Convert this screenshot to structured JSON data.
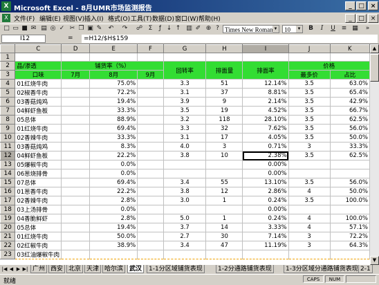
{
  "window": {
    "title": "Microsoft Excel - 8月UMR市场监测报告",
    "minimize": "_",
    "maximize": "□",
    "close": "×",
    "doc_min": "_",
    "doc_max": "□",
    "doc_close": "×"
  },
  "menu": [
    "文件(F)",
    "编辑(E)",
    "视图(V)",
    "插入(I)",
    "格式(O)",
    "工具(T)",
    "数据(D)",
    "窗口(W)",
    "帮助(H)"
  ],
  "toolbar": {
    "font": "Times New Roman",
    "size": "10",
    "bold": "B",
    "italic": "I",
    "underline": "U",
    "icons": [
      "new-icon",
      "open-icon",
      "save-icon",
      "print-icon",
      "preview-icon",
      "spell-icon",
      "cut-icon",
      "copy-icon",
      "paste-icon",
      "undo-icon",
      "redo-icon",
      "hyperlink-icon",
      "autosum-icon",
      "function-icon",
      "sort-asc-icon",
      "sort-desc-icon",
      "chart-icon",
      "drawing-icon",
      "zoom-icon",
      "help-icon"
    ]
  },
  "formula_bar": {
    "name_box": "I12",
    "fx": "=",
    "formula": "=H12/$H$159"
  },
  "columns": [
    "C",
    "D",
    "E",
    "F",
    "G",
    "H",
    "I",
    "J",
    "K"
  ],
  "selected_column": "I",
  "selected_row": "12",
  "header": {
    "pindaiqu": "品/渗透",
    "kouwei": "口味",
    "puhuo": "铺货率（%）",
    "jul": "7月",
    "aug": "8月",
    "sep": "9月",
    "huizhuan": "回转率",
    "paimian": "排面量",
    "paimianlv": "排面率",
    "jiage": "价格",
    "zuiduo": "最多价",
    "zhanbi": "占比"
  },
  "rows": [
    {
      "r": "1",
      "c": "",
      "d": "",
      "e": "",
      "f": "",
      "g": "",
      "h": "",
      "i": "",
      "j": "",
      "k": ""
    },
    {
      "r": "4",
      "c": "01红烧牛肉",
      "d": "",
      "e": "75.0%",
      "f": "",
      "g": "3.3",
      "h": "51",
      "i": "12.14%",
      "j": "3.5",
      "k": "63.0%"
    },
    {
      "r": "5",
      "c": "02椒香牛肉",
      "d": "",
      "e": "72.2%",
      "f": "",
      "g": "3.1",
      "h": "37",
      "i": "8.81%",
      "j": "3.5",
      "k": "65.4%"
    },
    {
      "r": "6",
      "c": "03香菇炖鸡",
      "d": "",
      "e": "19.4%",
      "f": "",
      "g": "3.9",
      "h": "9",
      "i": "2.14%",
      "j": "3.5",
      "k": "42.9%"
    },
    {
      "r": "7",
      "c": "04鲜虾鱼板",
      "d": "",
      "e": "33.3%",
      "f": "",
      "g": "3.5",
      "h": "19",
      "i": "4.52%",
      "j": "3.5",
      "k": "66.7%"
    },
    {
      "r": "8",
      "c": "05总体",
      "d": "",
      "e": "88.9%",
      "f": "",
      "g": "3.2",
      "h": "118",
      "i": "28.10%",
      "j": "3.5",
      "k": "62.5%"
    },
    {
      "r": "9",
      "c": "01红烧牛肉",
      "d": "",
      "e": "69.4%",
      "f": "",
      "g": "3.3",
      "h": "32",
      "i": "7.62%",
      "j": "3.5",
      "k": "56.0%"
    },
    {
      "r": "10",
      "c": "02香辣牛肉",
      "d": "",
      "e": "33.3%",
      "f": "",
      "g": "3.1",
      "h": "17",
      "i": "4.05%",
      "j": "3.5",
      "k": "50.0%"
    },
    {
      "r": "11",
      "c": "03香菇炖鸡",
      "d": "",
      "e": "8.3%",
      "f": "",
      "g": "4.0",
      "h": "3",
      "i": "0.71%",
      "j": "3",
      "k": "33.3%"
    },
    {
      "r": "12",
      "c": "04鲜虾鱼板",
      "d": "",
      "e": "22.2%",
      "f": "",
      "g": "3.8",
      "h": "10",
      "i": "2.38%",
      "j": "3.5",
      "k": "62.5%"
    },
    {
      "r": "13",
      "c": "05爆椒牛肉",
      "d": "",
      "e": "0.0%",
      "f": "",
      "g": "",
      "h": "",
      "i": "0.00%",
      "j": "",
      "k": ""
    },
    {
      "r": "14",
      "c": "06葱烧排骨",
      "d": "",
      "e": "0.0%",
      "f": "",
      "g": "",
      "h": "",
      "i": "0.00%",
      "j": "",
      "k": ""
    },
    {
      "r": "15",
      "c": "07总体",
      "d": "",
      "e": "69.4%",
      "f": "",
      "g": "3.4",
      "h": "55",
      "i": "13.10%",
      "j": "3.5",
      "k": "56.0%"
    },
    {
      "r": "16",
      "c": "01葱香牛肉",
      "d": "",
      "e": "22.2%",
      "f": "",
      "g": "3.8",
      "h": "12",
      "i": "2.86%",
      "j": "4",
      "k": "50.0%"
    },
    {
      "r": "17",
      "c": "02香辣牛肉",
      "d": "",
      "e": "2.8%",
      "f": "",
      "g": "3.0",
      "h": "1",
      "i": "0.24%",
      "j": "3.5",
      "k": "100.0%"
    },
    {
      "r": "18",
      "c": "03上汤排骨",
      "d": "",
      "e": "0.0%",
      "f": "",
      "g": "",
      "h": "",
      "i": "0.00%",
      "j": "",
      "k": ""
    },
    {
      "r": "19",
      "c": "04香脆鲜虾",
      "d": "",
      "e": "2.8%",
      "f": "",
      "g": "5.0",
      "h": "1",
      "i": "0.24%",
      "j": "4",
      "k": "100.0%"
    },
    {
      "r": "20",
      "c": "05总体",
      "d": "",
      "e": "19.4%",
      "f": "",
      "g": "3.7",
      "h": "14",
      "i": "3.33%",
      "j": "4",
      "k": "57.1%"
    },
    {
      "r": "21",
      "c": "01红烧牛肉",
      "d": "",
      "e": "50.0%",
      "f": "",
      "g": "2.7",
      "h": "30",
      "i": "7.14%",
      "j": "3",
      "k": "72.2%"
    },
    {
      "r": "22",
      "c": "02红椒牛肉",
      "d": "",
      "e": "38.9%",
      "f": "",
      "g": "3.4",
      "h": "47",
      "i": "11.19%",
      "j": "3",
      "k": "64.3%"
    },
    {
      "r": "23",
      "c": "03红油爆椒牛肉",
      "d": "",
      "e": "",
      "f": "",
      "g": "",
      "h": "",
      "i": "",
      "j": "",
      "k": ""
    }
  ],
  "tabs": [
    "广州",
    "西安",
    "北京",
    "天津",
    "哈尔滨",
    "武汉",
    "1-1分区域铺货表现",
    "1-2分通路铺货表现",
    "1-3分区域分通路铺货表现",
    "2-1"
  ],
  "active_tab": "武汉",
  "status": {
    "ready": "就绪",
    "caps": "CAPS",
    "num": "NUM"
  }
}
